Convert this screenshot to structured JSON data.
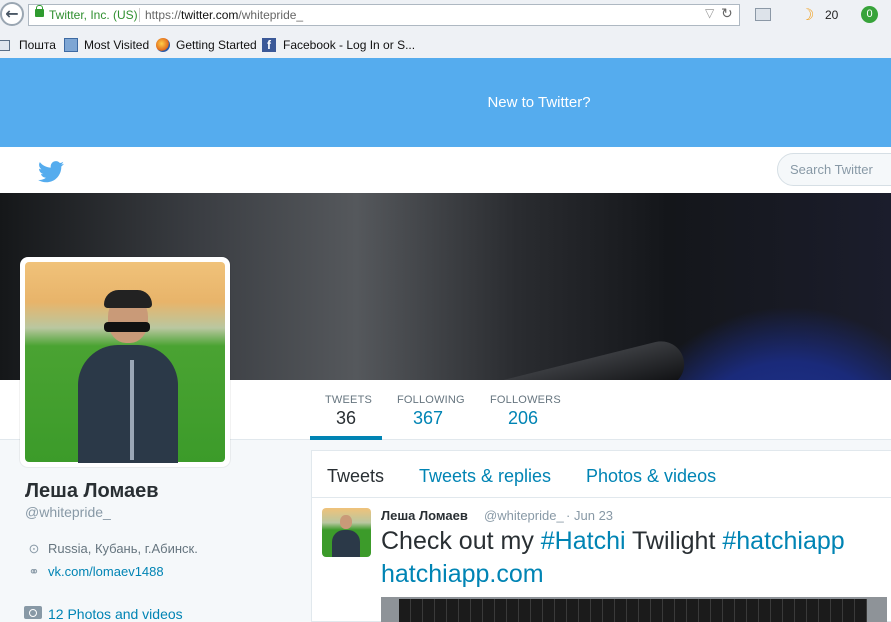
{
  "browser": {
    "identity": "Twitter, Inc. (US)",
    "url_prefix": "https://",
    "url_domain": "twitter.com",
    "url_path": "/whitepride_",
    "moon_count": "20",
    "green_badge": "0"
  },
  "bookmarks": [
    {
      "label": "Пошта"
    },
    {
      "label": "Most Visited"
    },
    {
      "label": "Getting Started"
    },
    {
      "label": "Facebook - Log In or S..."
    }
  ],
  "twitter": {
    "banner_text": "New to Twitter?",
    "search_placeholder": "Search Twitter",
    "colors": {
      "brand": "#55acee",
      "link": "#0084b4",
      "text": "#292f33",
      "muted": "#8899a6"
    }
  },
  "profile": {
    "name": "Леша Ломаев",
    "handle": "@whitepride_",
    "location": "Russia, Кубань, г.Абинск.",
    "website": "vk.com/lomaev1488",
    "photos": "12 Photos and videos"
  },
  "stats": [
    {
      "label": "TWEETS",
      "value": "36",
      "active": true
    },
    {
      "label": "FOLLOWING",
      "value": "367"
    },
    {
      "label": "FOLLOWERS",
      "value": "206"
    }
  ],
  "timeline_tabs": [
    {
      "label": "Tweets",
      "active": true
    },
    {
      "label": "Tweets & replies"
    },
    {
      "label": "Photos & videos"
    }
  ],
  "tweet": {
    "name": "Леша Ломаев",
    "handle": "@whitepride_",
    "separator": "·",
    "date": "Jun 23",
    "text_1": "Check out my ",
    "hashtag_1": "#Hatchi",
    "text_2": " Twilight ",
    "hashtag_2": "#hatchiapp",
    "link": "hatchiapp.com"
  }
}
